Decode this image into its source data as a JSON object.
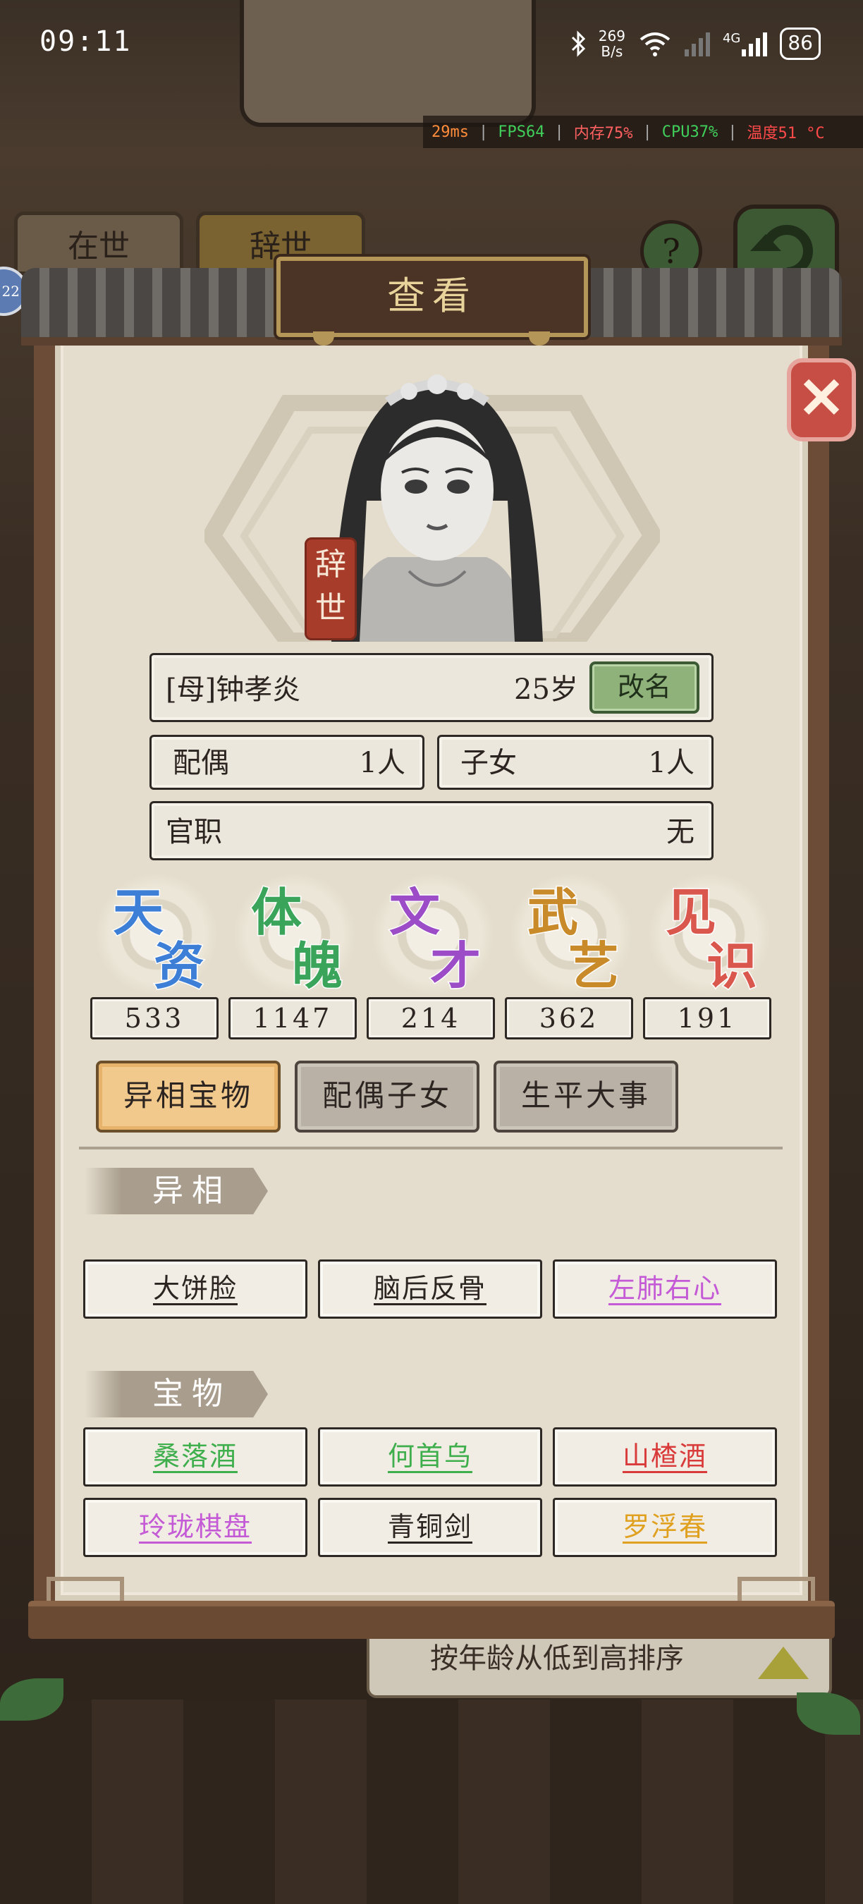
{
  "status_bar": {
    "time": "09:11",
    "net_speed_value": "269",
    "net_speed_unit": "B/s",
    "signal_label": "4G",
    "battery": "86"
  },
  "perf_overlay": {
    "ping": "29ms",
    "fps": "FPS64",
    "memory": "内存75%",
    "cpu": "CPU37%",
    "temperature": "温度51 °C"
  },
  "background": {
    "tab_alive": "在世",
    "tab_deceased": "辞世",
    "help": "?",
    "sort_label": "按年龄从低到高排序",
    "level_badge": "22"
  },
  "dialog": {
    "title": "查看",
    "status_seal": "辞世",
    "character": {
      "name": "[母]钟孝炎",
      "age": "25岁",
      "rename_label": "改名"
    },
    "spouse": {
      "label": "配偶",
      "value": "1人"
    },
    "children": {
      "label": "子女",
      "value": "1人"
    },
    "official_post": {
      "label": "官职",
      "value": "无"
    },
    "stats": [
      {
        "label_top": "天",
        "label_bottom": "资",
        "value": "533",
        "color": "#3d7fd6"
      },
      {
        "label_top": "体",
        "label_bottom": "魄",
        "value": "1147",
        "color": "#3aa55a"
      },
      {
        "label_top": "文",
        "label_bottom": "才",
        "value": "214",
        "color": "#9b4cc6"
      },
      {
        "label_top": "武",
        "label_bottom": "艺",
        "value": "362",
        "color": "#c98a2a"
      },
      {
        "label_top": "见",
        "label_bottom": "识",
        "value": "191",
        "color": "#d9574c"
      }
    ],
    "tabs": [
      {
        "label": "异相宝物",
        "active": true
      },
      {
        "label": "配偶子女",
        "active": false
      },
      {
        "label": "生平大事",
        "active": false
      }
    ],
    "traits_section": {
      "title": "异相",
      "items": [
        {
          "label": "大饼脸",
          "color": "#2b2420"
        },
        {
          "label": "脑后反骨",
          "color": "#2b2420"
        },
        {
          "label": "左肺右心",
          "color": "#c45ad6"
        }
      ]
    },
    "treasures_section": {
      "title": "宝物",
      "items": [
        {
          "label": "桑落酒",
          "color": "#3fae4c"
        },
        {
          "label": "何首乌",
          "color": "#3fae4c"
        },
        {
          "label": "山楂酒",
          "color": "#d93b3b"
        },
        {
          "label": "玲珑棋盘",
          "color": "#c45ad6"
        },
        {
          "label": "青铜剑",
          "color": "#2b2420"
        },
        {
          "label": "罗浮春",
          "color": "#e0a020"
        }
      ]
    }
  }
}
